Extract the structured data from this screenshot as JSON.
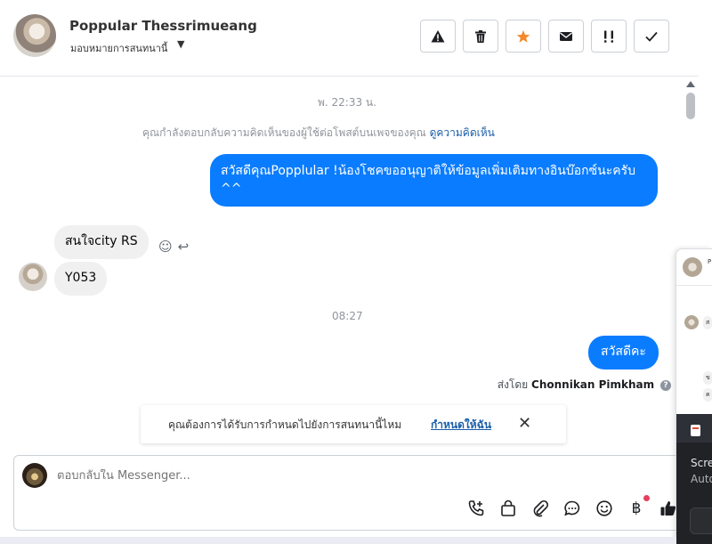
{
  "header": {
    "contact_name": "Poppular Thessrimueang",
    "assign_label": "มอบหมายการสนทนานี้",
    "actions": [
      {
        "icon": "warning-icon",
        "glyph": "⚠"
      },
      {
        "icon": "trash-icon",
        "glyph": "🗑"
      },
      {
        "icon": "star-icon",
        "glyph": "★",
        "color": "#f28a2c"
      },
      {
        "icon": "envelope-icon",
        "glyph": "✉"
      },
      {
        "icon": "priority-icon",
        "glyph": "!!"
      },
      {
        "icon": "check-icon",
        "glyph": "✓"
      }
    ]
  },
  "thread": {
    "timestamp_1": "พ. 22:33 น.",
    "notice_text": "คุณกำลังตอบกลับความคิดเห็นของผู้ใช้ต่อโพสต์บนเพจของคุณ",
    "notice_link": "ดูความคิดเห็น",
    "messages": [
      {
        "direction": "out",
        "text": "สวัสดีคุณPopplular !น้องโชคขออนุญาติให้ข้อมูลเพิ่มเติมทางอินบ๊อกซ์นะครับ ^^"
      },
      {
        "direction": "in",
        "text": "สนใจcity RS"
      },
      {
        "direction": "in",
        "text": "Y053"
      },
      {
        "direction": "out",
        "text": "สวัสดีคะ"
      }
    ],
    "timestamp_2": "08:27",
    "sent_by_label": "ส่งโดย",
    "sent_by_name": "Chonnikan Pimkham",
    "help_glyph": "?"
  },
  "banner": {
    "text": "คุณต้องการได้รับการกำหนดไปยังการสนทนานี้ไหม",
    "link": "กำหนดให้ฉัน",
    "close_glyph": "✕"
  },
  "composer": {
    "placeholder": "ตอบกลับใน Messenger...",
    "tools": [
      "phone-add-icon",
      "shopping-bag-icon",
      "paperclip-icon",
      "chat-bubble-icon",
      "emoji-icon",
      "baht-icon",
      "thumbs-up-icon"
    ]
  },
  "side_panel": {
    "line_1": "Scre",
    "line_2": "Auto"
  },
  "colors": {
    "accent": "#0a7cff",
    "link": "#1a5ea8",
    "star": "#f28a2c"
  }
}
